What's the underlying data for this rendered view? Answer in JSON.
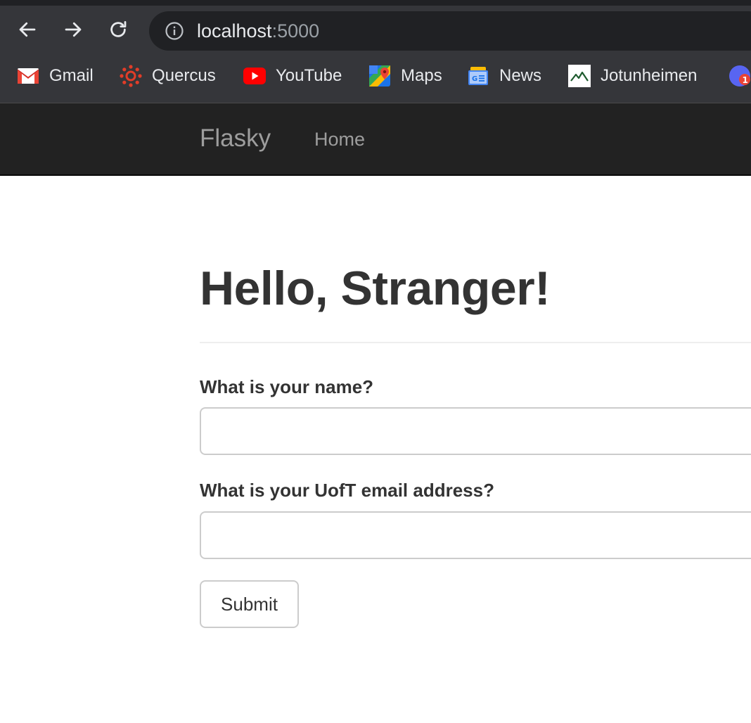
{
  "browser": {
    "url_host": "localhost",
    "url_port": ":5000",
    "bookmarks": [
      {
        "label": "Gmail",
        "icon": "gmail-icon"
      },
      {
        "label": "Quercus",
        "icon": "quercus-icon"
      },
      {
        "label": "YouTube",
        "icon": "youtube-icon"
      },
      {
        "label": "Maps",
        "icon": "maps-icon"
      },
      {
        "label": "News",
        "icon": "news-icon"
      },
      {
        "label": "Jotunheimen",
        "icon": "jotunheimen-icon"
      }
    ],
    "extension_badge": "1"
  },
  "navbar": {
    "brand": "Flasky",
    "links": [
      {
        "label": "Home"
      }
    ]
  },
  "main": {
    "title": "Hello, Stranger!",
    "form": {
      "name_label": "What is your name?",
      "name_value": "",
      "email_label": "What is your UofT email address?",
      "email_value": "",
      "submit_label": "Submit"
    }
  },
  "colors": {
    "chrome_bg": "#35363a",
    "omnibox_bg": "#202124",
    "navbar_bg": "#222222",
    "navbar_text": "#9d9d9d",
    "text": "#333333"
  }
}
